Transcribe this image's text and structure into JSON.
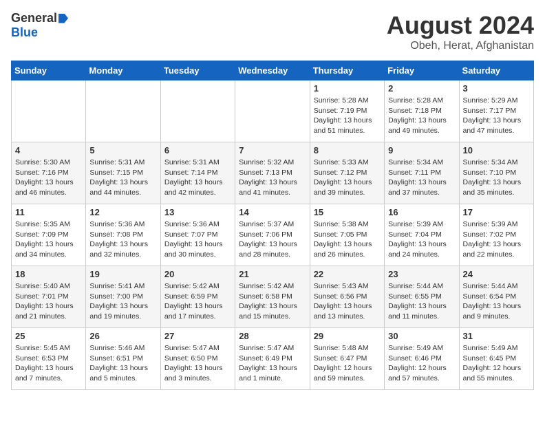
{
  "logo": {
    "general": "General",
    "blue": "Blue"
  },
  "title": "August 2024",
  "subtitle": "Obeh, Herat, Afghanistan",
  "calendar": {
    "headers": [
      "Sunday",
      "Monday",
      "Tuesday",
      "Wednesday",
      "Thursday",
      "Friday",
      "Saturday"
    ],
    "weeks": [
      [
        {
          "day": "",
          "info": ""
        },
        {
          "day": "",
          "info": ""
        },
        {
          "day": "",
          "info": ""
        },
        {
          "day": "",
          "info": ""
        },
        {
          "day": "1",
          "info": "Sunrise: 5:28 AM\nSunset: 7:19 PM\nDaylight: 13 hours\nand 51 minutes."
        },
        {
          "day": "2",
          "info": "Sunrise: 5:28 AM\nSunset: 7:18 PM\nDaylight: 13 hours\nand 49 minutes."
        },
        {
          "day": "3",
          "info": "Sunrise: 5:29 AM\nSunset: 7:17 PM\nDaylight: 13 hours\nand 47 minutes."
        }
      ],
      [
        {
          "day": "4",
          "info": "Sunrise: 5:30 AM\nSunset: 7:16 PM\nDaylight: 13 hours\nand 46 minutes."
        },
        {
          "day": "5",
          "info": "Sunrise: 5:31 AM\nSunset: 7:15 PM\nDaylight: 13 hours\nand 44 minutes."
        },
        {
          "day": "6",
          "info": "Sunrise: 5:31 AM\nSunset: 7:14 PM\nDaylight: 13 hours\nand 42 minutes."
        },
        {
          "day": "7",
          "info": "Sunrise: 5:32 AM\nSunset: 7:13 PM\nDaylight: 13 hours\nand 41 minutes."
        },
        {
          "day": "8",
          "info": "Sunrise: 5:33 AM\nSunset: 7:12 PM\nDaylight: 13 hours\nand 39 minutes."
        },
        {
          "day": "9",
          "info": "Sunrise: 5:34 AM\nSunset: 7:11 PM\nDaylight: 13 hours\nand 37 minutes."
        },
        {
          "day": "10",
          "info": "Sunrise: 5:34 AM\nSunset: 7:10 PM\nDaylight: 13 hours\nand 35 minutes."
        }
      ],
      [
        {
          "day": "11",
          "info": "Sunrise: 5:35 AM\nSunset: 7:09 PM\nDaylight: 13 hours\nand 34 minutes."
        },
        {
          "day": "12",
          "info": "Sunrise: 5:36 AM\nSunset: 7:08 PM\nDaylight: 13 hours\nand 32 minutes."
        },
        {
          "day": "13",
          "info": "Sunrise: 5:36 AM\nSunset: 7:07 PM\nDaylight: 13 hours\nand 30 minutes."
        },
        {
          "day": "14",
          "info": "Sunrise: 5:37 AM\nSunset: 7:06 PM\nDaylight: 13 hours\nand 28 minutes."
        },
        {
          "day": "15",
          "info": "Sunrise: 5:38 AM\nSunset: 7:05 PM\nDaylight: 13 hours\nand 26 minutes."
        },
        {
          "day": "16",
          "info": "Sunrise: 5:39 AM\nSunset: 7:04 PM\nDaylight: 13 hours\nand 24 minutes."
        },
        {
          "day": "17",
          "info": "Sunrise: 5:39 AM\nSunset: 7:02 PM\nDaylight: 13 hours\nand 22 minutes."
        }
      ],
      [
        {
          "day": "18",
          "info": "Sunrise: 5:40 AM\nSunset: 7:01 PM\nDaylight: 13 hours\nand 21 minutes."
        },
        {
          "day": "19",
          "info": "Sunrise: 5:41 AM\nSunset: 7:00 PM\nDaylight: 13 hours\nand 19 minutes."
        },
        {
          "day": "20",
          "info": "Sunrise: 5:42 AM\nSunset: 6:59 PM\nDaylight: 13 hours\nand 17 minutes."
        },
        {
          "day": "21",
          "info": "Sunrise: 5:42 AM\nSunset: 6:58 PM\nDaylight: 13 hours\nand 15 minutes."
        },
        {
          "day": "22",
          "info": "Sunrise: 5:43 AM\nSunset: 6:56 PM\nDaylight: 13 hours\nand 13 minutes."
        },
        {
          "day": "23",
          "info": "Sunrise: 5:44 AM\nSunset: 6:55 PM\nDaylight: 13 hours\nand 11 minutes."
        },
        {
          "day": "24",
          "info": "Sunrise: 5:44 AM\nSunset: 6:54 PM\nDaylight: 13 hours\nand 9 minutes."
        }
      ],
      [
        {
          "day": "25",
          "info": "Sunrise: 5:45 AM\nSunset: 6:53 PM\nDaylight: 13 hours\nand 7 minutes."
        },
        {
          "day": "26",
          "info": "Sunrise: 5:46 AM\nSunset: 6:51 PM\nDaylight: 13 hours\nand 5 minutes."
        },
        {
          "day": "27",
          "info": "Sunrise: 5:47 AM\nSunset: 6:50 PM\nDaylight: 13 hours\nand 3 minutes."
        },
        {
          "day": "28",
          "info": "Sunrise: 5:47 AM\nSunset: 6:49 PM\nDaylight: 13 hours\nand 1 minute."
        },
        {
          "day": "29",
          "info": "Sunrise: 5:48 AM\nSunset: 6:47 PM\nDaylight: 12 hours\nand 59 minutes."
        },
        {
          "day": "30",
          "info": "Sunrise: 5:49 AM\nSunset: 6:46 PM\nDaylight: 12 hours\nand 57 minutes."
        },
        {
          "day": "31",
          "info": "Sunrise: 5:49 AM\nSunset: 6:45 PM\nDaylight: 12 hours\nand 55 minutes."
        }
      ]
    ]
  }
}
